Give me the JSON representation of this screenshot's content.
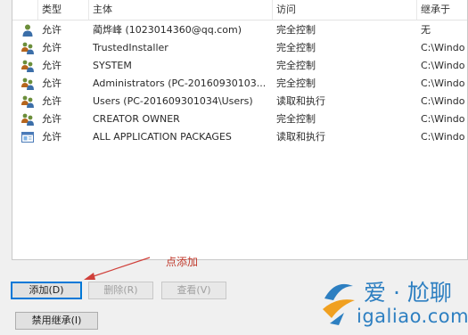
{
  "columns": {
    "type": "类型",
    "principal": "主体",
    "access": "访问",
    "inherited_from": "继承于"
  },
  "entries": [
    {
      "type": "允许",
      "principal": "蔺烨峰 (1023014360@qq.com)",
      "access": "完全控制",
      "inherited_from": "无",
      "icon": "single-user-icon"
    },
    {
      "type": "允许",
      "principal": "TrustedInstaller",
      "access": "完全控制",
      "inherited_from": "C:\\Windo",
      "icon": "user-group-icon"
    },
    {
      "type": "允许",
      "principal": "SYSTEM",
      "access": "完全控制",
      "inherited_from": "C:\\Windo",
      "icon": "user-group-icon"
    },
    {
      "type": "允许",
      "principal": "Administrators (PC-20160930103...",
      "access": "完全控制",
      "inherited_from": "C:\\Windo",
      "icon": "user-group-icon"
    },
    {
      "type": "允许",
      "principal": "Users (PC-201609301034\\Users)",
      "access": "读取和执行",
      "inherited_from": "C:\\Windo",
      "icon": "user-group-icon"
    },
    {
      "type": "允许",
      "principal": "CREATOR OWNER",
      "access": "完全控制",
      "inherited_from": "C:\\Windo",
      "icon": "user-group-icon"
    },
    {
      "type": "允许",
      "principal": "ALL APPLICATION PACKAGES",
      "access": "读取和执行",
      "inherited_from": "C:\\Windo",
      "icon": "package-icon"
    }
  ],
  "buttons": {
    "add": "添加(D)",
    "remove": "删除(R)",
    "view": "查看(V)",
    "disable_inheritance": "禁用继承(I)"
  },
  "annotation": "点添加",
  "watermark": {
    "line1": "爱 · 尬聊",
    "line2": "igaliao.com"
  },
  "colors": {
    "annotation": "#c0392b",
    "watermark": "#2d7fc1",
    "selected_border": "#0078d7"
  }
}
